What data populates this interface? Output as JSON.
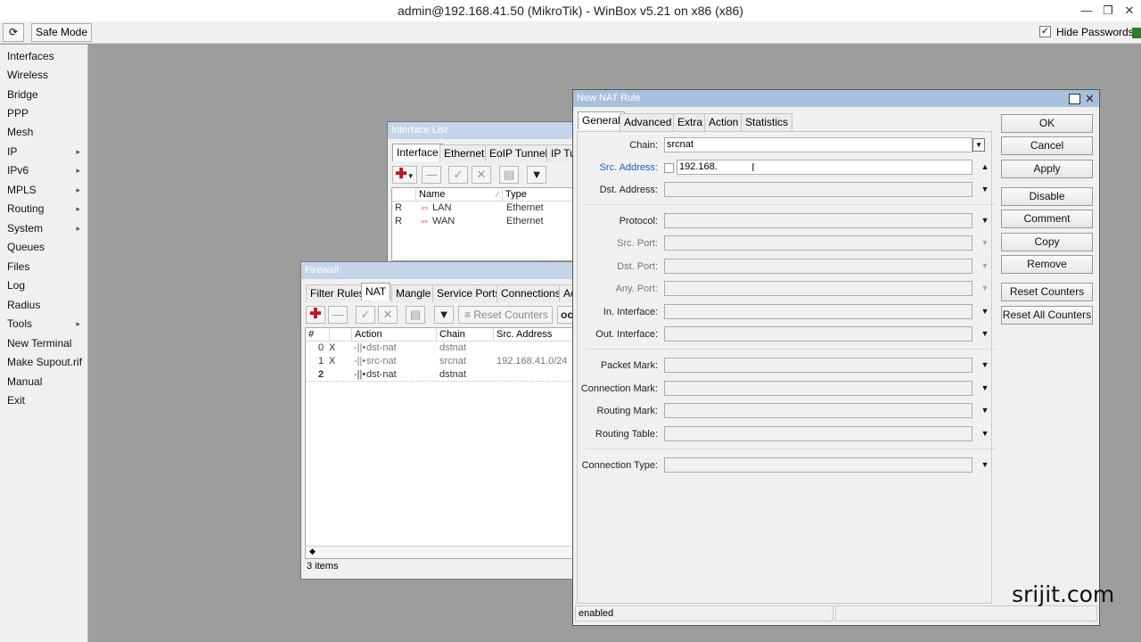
{
  "app": {
    "title": "admin@192.168.41.50 (MikroTik) - WinBox v5.21 on x86 (x86)",
    "watermark": "srijit.com"
  },
  "toolbar": {
    "refresh_icon": "refresh-icon",
    "safe_mode_label": "Safe Mode",
    "hide_passwords_label": "Hide Passwords",
    "hide_passwords_checked": true
  },
  "sidebar": {
    "items": [
      {
        "label": "Interfaces",
        "submenu": false
      },
      {
        "label": "Wireless",
        "submenu": false
      },
      {
        "label": "Bridge",
        "submenu": false
      },
      {
        "label": "PPP",
        "submenu": false
      },
      {
        "label": "Mesh",
        "submenu": false
      },
      {
        "label": "IP",
        "submenu": true
      },
      {
        "label": "IPv6",
        "submenu": true
      },
      {
        "label": "MPLS",
        "submenu": true
      },
      {
        "label": "Routing",
        "submenu": true
      },
      {
        "label": "System",
        "submenu": true
      },
      {
        "label": "Queues",
        "submenu": false
      },
      {
        "label": "Files",
        "submenu": false
      },
      {
        "label": "Log",
        "submenu": false
      },
      {
        "label": "Radius",
        "submenu": false
      },
      {
        "label": "Tools",
        "submenu": true
      },
      {
        "label": "New Terminal",
        "submenu": false
      },
      {
        "label": "Make Supout.rif",
        "submenu": false
      },
      {
        "label": "Manual",
        "submenu": false
      },
      {
        "label": "Exit",
        "submenu": false
      }
    ]
  },
  "interface_list": {
    "title": "Interface List",
    "tabs": [
      "Interface",
      "Ethernet",
      "EoIP Tunnel",
      "IP Tu"
    ],
    "columns": [
      "Name",
      "Type"
    ],
    "rows": [
      {
        "flag": "R",
        "name": "LAN",
        "type": "Ethernet"
      },
      {
        "flag": "R",
        "name": "WAN",
        "type": "Ethernet"
      }
    ]
  },
  "firewall": {
    "title": "Firewall",
    "tabs": [
      "Filter Rules",
      "NAT",
      "Mangle",
      "Service Ports",
      "Connections",
      "Ac"
    ],
    "reset_counters_label": "Reset Counters",
    "cut_label": "oc",
    "columns": [
      "#",
      "Action",
      "Chain",
      "Src. Address"
    ],
    "rows": [
      {
        "num": "0",
        "flag": "X",
        "action": "dst-nat",
        "chain": "dstnat",
        "src": ""
      },
      {
        "num": "1",
        "flag": "X",
        "action": "src-nat",
        "chain": "srcnat",
        "src": "192.168.41.0/24"
      },
      {
        "num": "2",
        "flag": "",
        "action": "dst-nat",
        "chain": "dstnat",
        "src": ""
      }
    ],
    "status": "3 items"
  },
  "nat_rule": {
    "title": "New NAT Rule",
    "tabs": [
      "General",
      "Advanced",
      "Extra",
      "Action",
      "Statistics"
    ],
    "fields": {
      "chain_label": "Chain:",
      "chain_value": "srcnat",
      "src_address_label": "Src. Address:",
      "src_address_value": "192.168.",
      "dst_address_label": "Dst. Address:",
      "protocol_label": "Protocol:",
      "src_port_label": "Src. Port:",
      "dst_port_label": "Dst. Port:",
      "any_port_label": "Any. Port:",
      "in_interface_label": "In. Interface:",
      "out_interface_label": "Out. Interface:",
      "packet_mark_label": "Packet Mark:",
      "connection_mark_label": "Connection Mark:",
      "routing_mark_label": "Routing Mark:",
      "routing_table_label": "Routing Table:",
      "connection_type_label": "Connection Type:"
    },
    "buttons": {
      "ok": "OK",
      "cancel": "Cancel",
      "apply": "Apply",
      "disable": "Disable",
      "comment": "Comment",
      "copy": "Copy",
      "remove": "Remove",
      "reset_counters": "Reset Counters",
      "reset_all_counters": "Reset All Counters"
    },
    "status": "enabled"
  }
}
